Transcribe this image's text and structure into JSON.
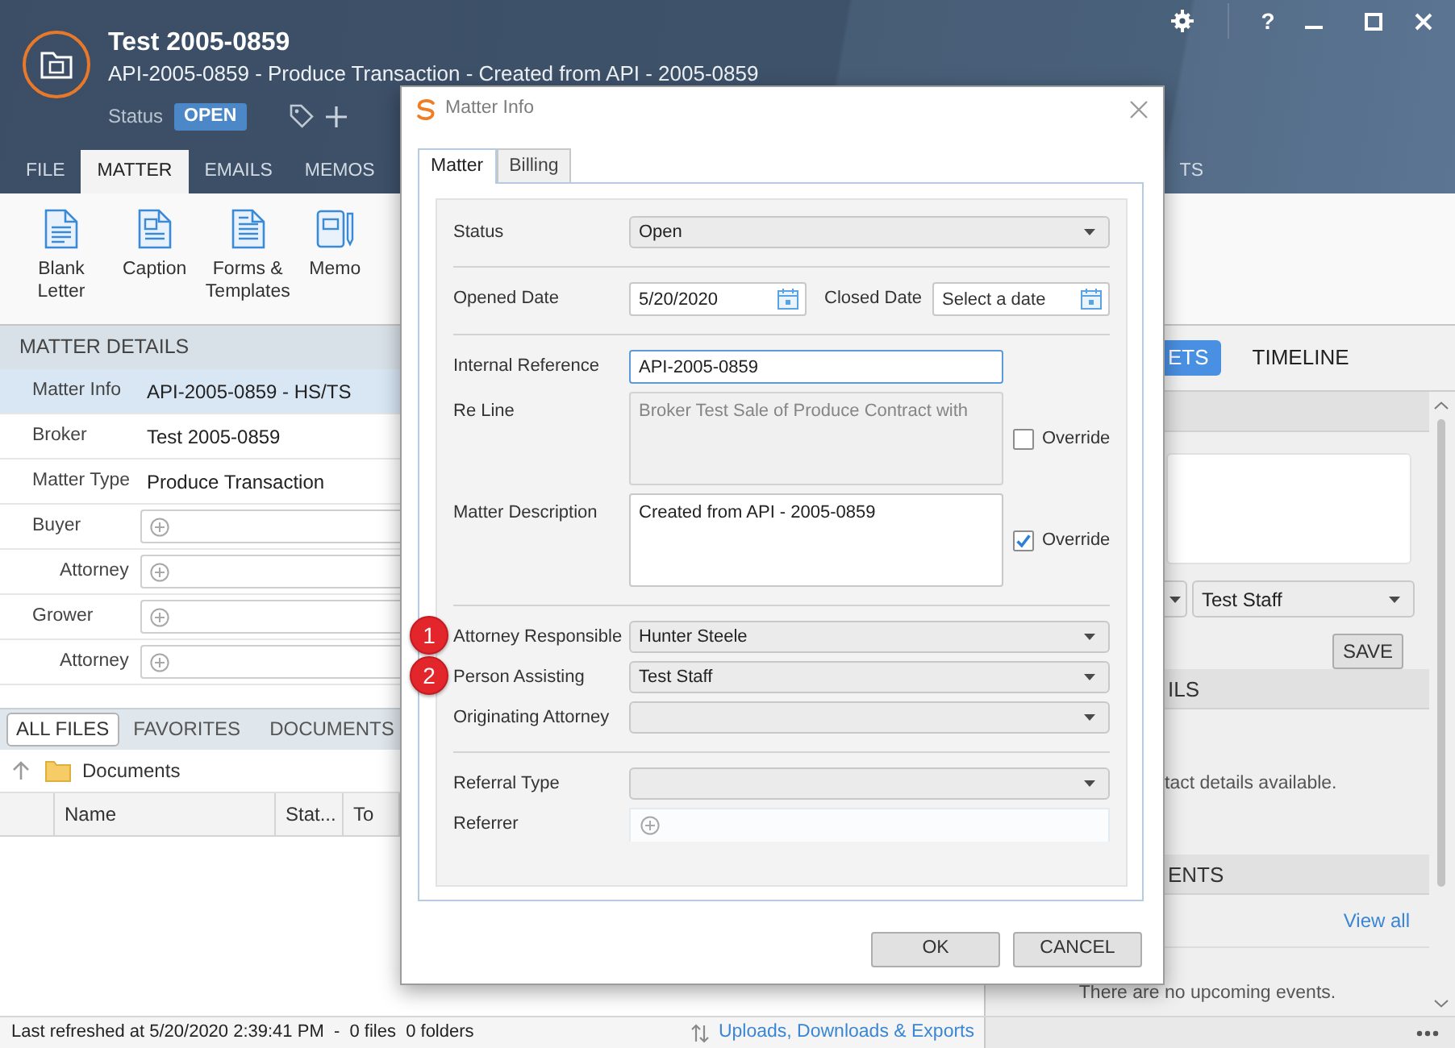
{
  "header": {
    "title": "Test 2005-0859",
    "subtitle": "API-2005-0859 - Produce Transaction - Created from API - 2005-0859",
    "status_label": "Status",
    "status": "OPEN",
    "help": "?"
  },
  "ribbon_tabs": [
    {
      "label": "FILE",
      "selected": false
    },
    {
      "label": "MATTER",
      "selected": true
    },
    {
      "label": "EMAILS",
      "selected": false
    },
    {
      "label": "MEMOS",
      "selected": false
    }
  ],
  "ribbon_tabs_right": [
    {
      "label": "TS",
      "selected": false
    }
  ],
  "toolbar": [
    {
      "label": "Blank Letter",
      "kind": "letter"
    },
    {
      "label": "Caption",
      "kind": "caption"
    },
    {
      "label": "Forms & Templates",
      "kind": "template"
    },
    {
      "label": "Memo",
      "kind": "memo"
    }
  ],
  "matter_details": {
    "heading": "MATTER DETAILS",
    "rows": [
      {
        "label": "Matter Info",
        "kind": "text",
        "value": "API-2005-0859 - HS/TS",
        "selected": true
      },
      {
        "label": "Broker",
        "kind": "text",
        "value": "Test 2005-0859",
        "selected": false
      },
      {
        "label": "Matter Type",
        "kind": "text",
        "value": "Produce Transaction",
        "selected": false
      },
      {
        "label": "Buyer",
        "kind": "picker",
        "selected": false,
        "children": [
          {
            "label": "Attorney",
            "kind": "picker",
            "selected": false
          }
        ]
      },
      {
        "label": "Grower",
        "kind": "picker",
        "selected": false,
        "children": [
          {
            "label": "Attorney",
            "kind": "picker",
            "selected": false
          }
        ]
      }
    ]
  },
  "file_tabs": [
    {
      "label": "ALL FILES",
      "selected": true
    },
    {
      "label": "FAVORITES",
      "selected": false
    },
    {
      "label": "DOCUMENTS",
      "selected": false
    }
  ],
  "breadcrumb": {
    "folder": "Documents"
  },
  "file_table": {
    "columns": [
      "Name",
      "Stat...",
      "To"
    ]
  },
  "right_panel": {
    "tabs": [
      {
        "label": "ETS",
        "selected": true
      },
      {
        "label": "TIMELINE",
        "selected": false
      }
    ],
    "note": {
      "staff": "Test Staff",
      "save": "SAVE"
    },
    "sections": [
      {
        "heading": "ILS",
        "message": "tact details available."
      },
      {
        "heading": "ENTS",
        "link": "View all",
        "message": "There are no upcoming events."
      }
    ]
  },
  "status_bar": {
    "summary": "Last refreshed at 5/20/2020 2:39:41 PM  -  0 files  0 folders",
    "link": "Uploads, Downloads & Exports"
  },
  "dialog": {
    "title": "Matter Info",
    "tabs": [
      {
        "label": "Matter",
        "selected": true
      },
      {
        "label": "Billing",
        "selected": false
      }
    ],
    "sections": [
      {
        "fields": [
          {
            "kind": "select",
            "label": "Status",
            "value": "Open"
          }
        ]
      },
      {
        "fields": [
          {
            "kind": "date_pair",
            "label": "Opened Date",
            "value": "5/20/2020",
            "end_label": "Closed Date",
            "end_placeholder": "Select a date"
          }
        ]
      },
      {
        "fields": [
          {
            "kind": "input",
            "label": "Internal Reference",
            "value": "API-2005-0859",
            "focused": true
          },
          {
            "kind": "textarea",
            "label": "Re Line",
            "value": "Broker Test Sale of Produce Contract with",
            "disabled": true,
            "override": {
              "label": "Override",
              "checked": false
            }
          },
          {
            "kind": "textarea",
            "label": "Matter Description",
            "value": "Created from API - 2005-0859",
            "disabled": false,
            "override": {
              "label": "Override",
              "checked": true
            }
          }
        ]
      },
      {
        "fields": [
          {
            "kind": "select",
            "label": "Attorney Responsible",
            "value": "Hunter Steele",
            "marker": "1"
          },
          {
            "kind": "select",
            "label": "Person Assisting",
            "value": "Test Staff",
            "marker": "2"
          },
          {
            "kind": "select",
            "label": "Originating Attorney"
          }
        ]
      },
      {
        "fields": [
          {
            "kind": "select",
            "label": "Referral Type"
          },
          {
            "kind": "picker",
            "label": "Referrer"
          }
        ]
      }
    ],
    "buttons": [
      "OK",
      "CANCEL"
    ]
  }
}
